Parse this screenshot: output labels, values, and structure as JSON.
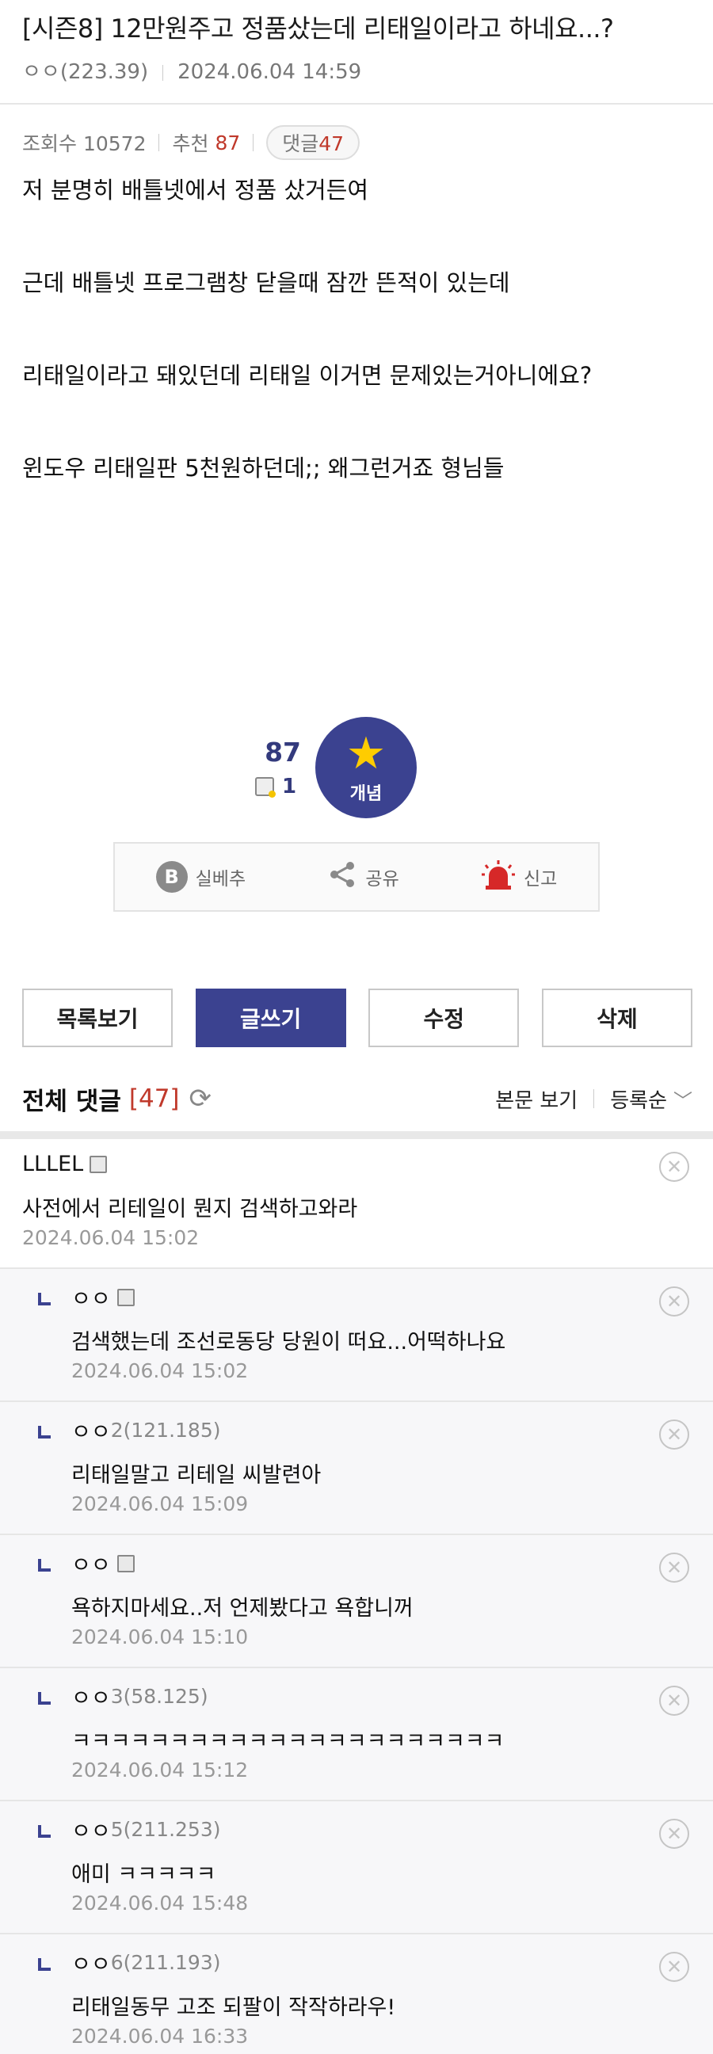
{
  "post": {
    "title": "[시즌8] 12만원주고 정품샀는데 리태일이라고 하네요...?",
    "author": "ㅇㅇ(223.39)",
    "datetime": "2024.06.04 14:59",
    "views_label": "조회수 10572",
    "recommend_label": "추천",
    "recommend_count": "87",
    "comments_label": "댓글",
    "comments_count": "47",
    "body": [
      "저 분명히 배틀넷에서 정품 샀거든여",
      "근데 배틀넷 프로그램창 닫을때 잠깐 뜬적이 있는데",
      "리태일이라고 돼있던데 리태일 이거면 문제있는거아니에요?",
      "윈도우 리태일판 5천원하던데;; 왜그런거죠 형님들"
    ]
  },
  "vote": {
    "count": "87",
    "sub_count": "1",
    "concept_label": "개념",
    "icons": {
      "concept": "star-icon",
      "sub": "memo-icon"
    },
    "colors": {
      "accent": "#3b4290",
      "star": "#ffcc00",
      "red": "#c0392b"
    }
  },
  "share": {
    "silbe_label": "실베추",
    "share_label": "공유",
    "report_label": "신고"
  },
  "buttons": {
    "list": "목록보기",
    "write": "글쓰기",
    "edit": "수정",
    "delete": "삭제"
  },
  "comment_header": {
    "title": "전체 댓글",
    "count": "[47]",
    "view_body": "본문 보기",
    "sort": "등록순"
  },
  "comments": [
    {
      "author": "LLLEL",
      "ip": "",
      "memo": true,
      "text": "사전에서 리테일이 뭔지 검색하고와라",
      "date": "2024.06.04 15:02",
      "reply": false
    },
    {
      "author": "ㅇㅇ",
      "ip": "",
      "memo": true,
      "text": "검색했는데 조선로동당 당원이 떠요...어떡하나요",
      "date": "2024.06.04 15:02",
      "reply": true
    },
    {
      "author": "ㅇㅇ",
      "ip": "2(121.185)",
      "memo": false,
      "text": "리태일말고 리테일 씨발련아",
      "date": "2024.06.04 15:09",
      "reply": true
    },
    {
      "author": "ㅇㅇ",
      "ip": "",
      "memo": true,
      "text": "욕하지마세요..저 언제봤다고 욕합니꺼",
      "date": "2024.06.04 15:10",
      "reply": true
    },
    {
      "author": "ㅇㅇ",
      "ip": "3(58.125)",
      "memo": false,
      "text": "ㅋㅋㅋㅋㅋㅋㅋㅋㅋㅋㅋㅋㅋㅋㅋㅋㅋㅋㅋㅋㅋㅋ",
      "date": "2024.06.04 15:12",
      "reply": true
    },
    {
      "author": "ㅇㅇ",
      "ip": "5(211.253)",
      "memo": false,
      "text": "애미 ㅋㅋㅋㅋㅋ",
      "date": "2024.06.04 15:48",
      "reply": true
    },
    {
      "author": "ㅇㅇ",
      "ip": "6(211.193)",
      "memo": false,
      "text": "리태일동무 고조 되팔이 작작하라우!",
      "date": "2024.06.04 16:33",
      "reply": true
    }
  ]
}
